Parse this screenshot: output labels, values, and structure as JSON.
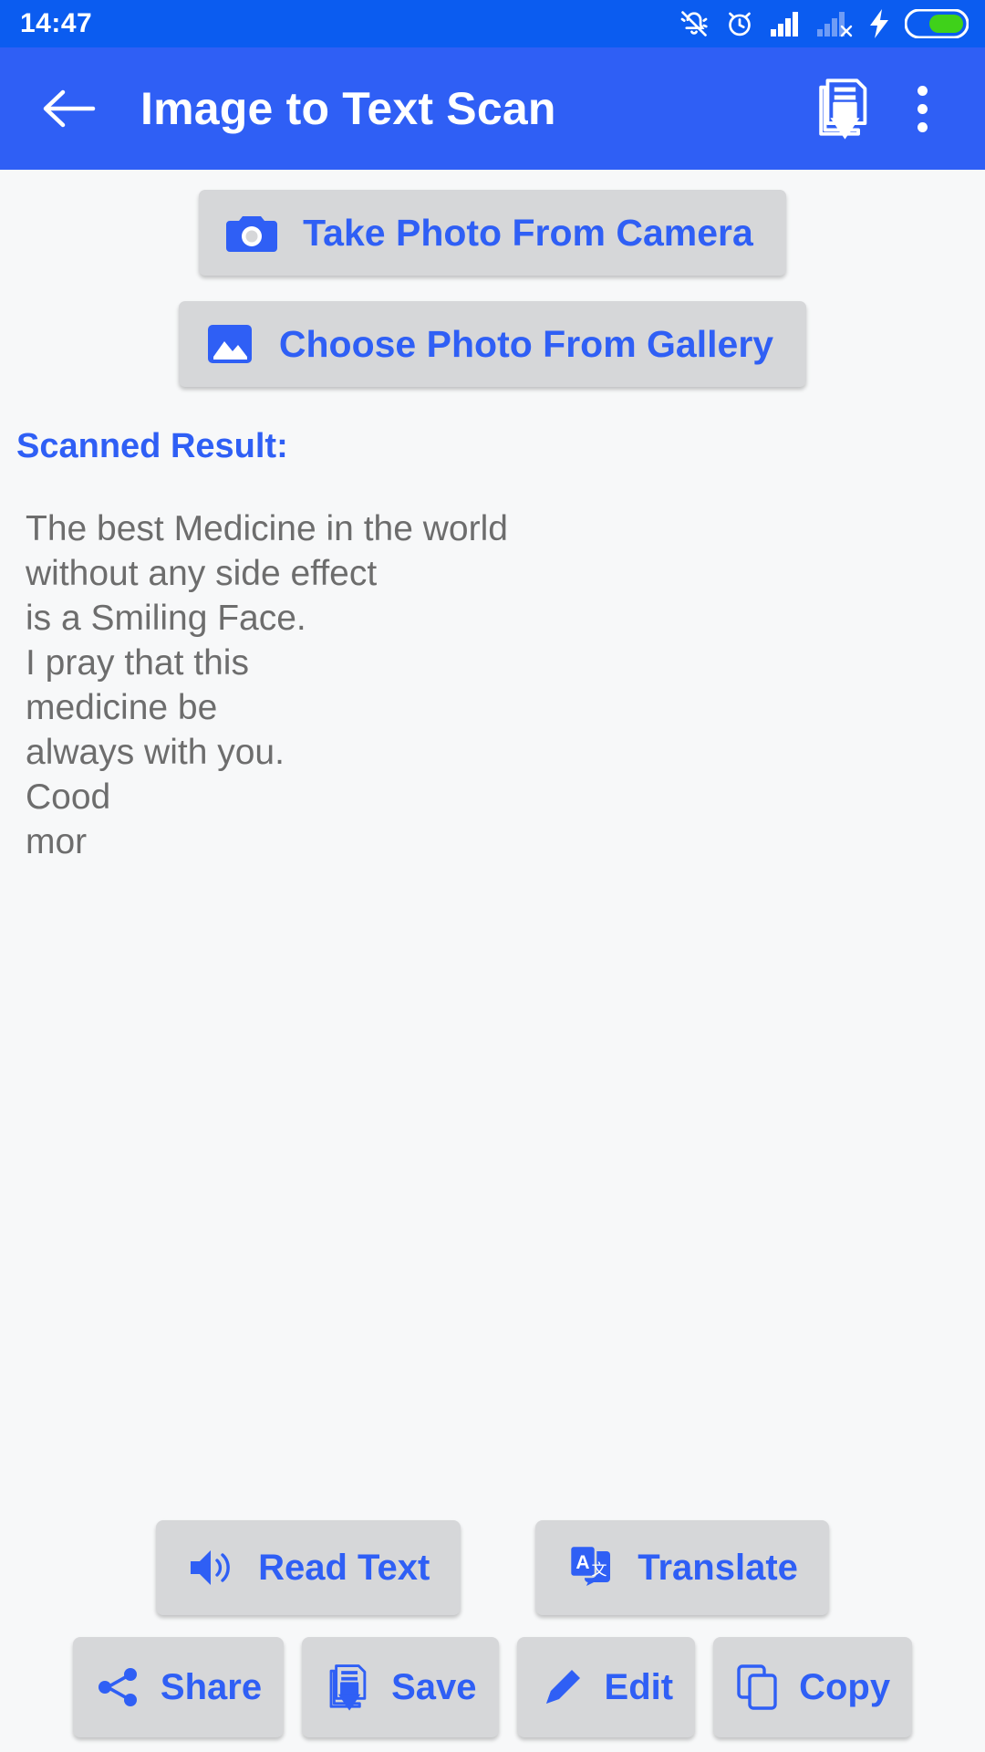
{
  "statusbar": {
    "time": "14:47",
    "icons": [
      "bell-muted-icon",
      "alarm-clock-icon",
      "signal-full-icon",
      "signal-no-sim-icon",
      "charging-bolt-icon",
      "battery-icon"
    ]
  },
  "appbar": {
    "title": "Image to Text Scan",
    "back_icon": "back-arrow-icon",
    "save_icon": "save-document-icon",
    "overflow_icon": "overflow-menu-icon"
  },
  "source_buttons": [
    {
      "label": "Take Photo From Camera",
      "icon": "camera-icon"
    },
    {
      "label": "Choose Photo From Gallery",
      "icon": "gallery-image-icon"
    }
  ],
  "result": {
    "heading": "Scanned Result:",
    "text": "The best Medicine in the world\nwithout any side effect\nis a Smiling Face.\nI pray that this\nmedicine be\nalways with you.\nCood\nmor"
  },
  "main_actions": [
    {
      "label": "Read Text",
      "icon": "speaker-volume-icon"
    },
    {
      "label": "Translate",
      "icon": "translate-icon"
    }
  ],
  "sub_actions": [
    {
      "label": "Share",
      "icon": "share-nodes-icon"
    },
    {
      "label": "Save",
      "icon": "save-document-icon"
    },
    {
      "label": "Edit",
      "icon": "pencil-icon"
    },
    {
      "label": "Copy",
      "icon": "copy-icon"
    }
  ],
  "colors": {
    "status_bar": "#0b5cf0",
    "app_bar": "#2f5ff5",
    "accent_blue": "#2f5ff5",
    "button_grey": "#d6d7d9",
    "page_bg": "#f7f8f9",
    "body_text": "#6d6d6d",
    "battery_green": "#3fd11a"
  }
}
